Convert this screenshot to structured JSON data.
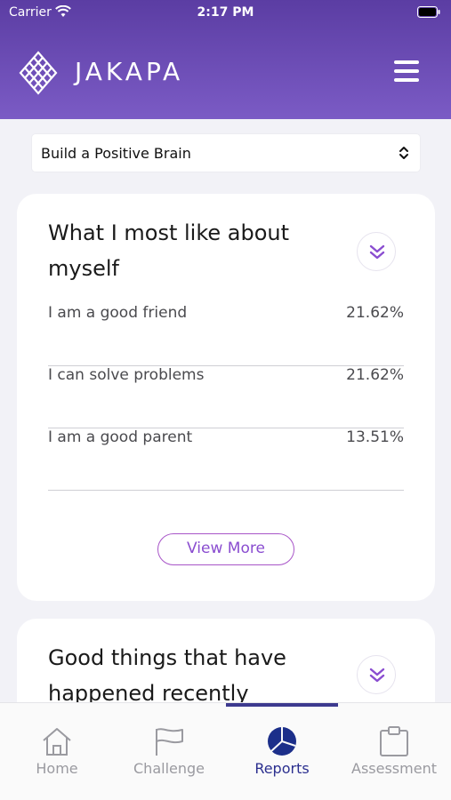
{
  "status_bar": {
    "carrier": "Carrier",
    "time": "2:17 PM"
  },
  "header": {
    "brand": "JAKAPA",
    "logo_icon": "diamond-lattice-logo",
    "menu_icon": "hamburger-menu-icon"
  },
  "selector": {
    "selected": "Build a Positive Brain"
  },
  "cards": [
    {
      "title": "What I most like about myself",
      "rows": [
        {
          "label": "I am a good friend",
          "value": "21.62%"
        },
        {
          "label": "I can solve problems",
          "value": "21.62%"
        },
        {
          "label": "I am a good parent",
          "value": "13.51%"
        }
      ],
      "view_more": "View More"
    },
    {
      "title": "Good things that have happened recently"
    }
  ],
  "tabbar": {
    "tabs": [
      {
        "label": "Home",
        "icon": "home-icon"
      },
      {
        "label": "Challenge",
        "icon": "flag-icon"
      },
      {
        "label": "Reports",
        "icon": "pie-chart-icon"
      },
      {
        "label": "Assessment",
        "icon": "clipboard-icon"
      }
    ],
    "active": "Reports"
  },
  "colors": {
    "header_top": "#5b3da3",
    "header_bottom": "#7b5bc5",
    "accent": "#8a4dd0",
    "active_tab": "#2b2f8f"
  }
}
